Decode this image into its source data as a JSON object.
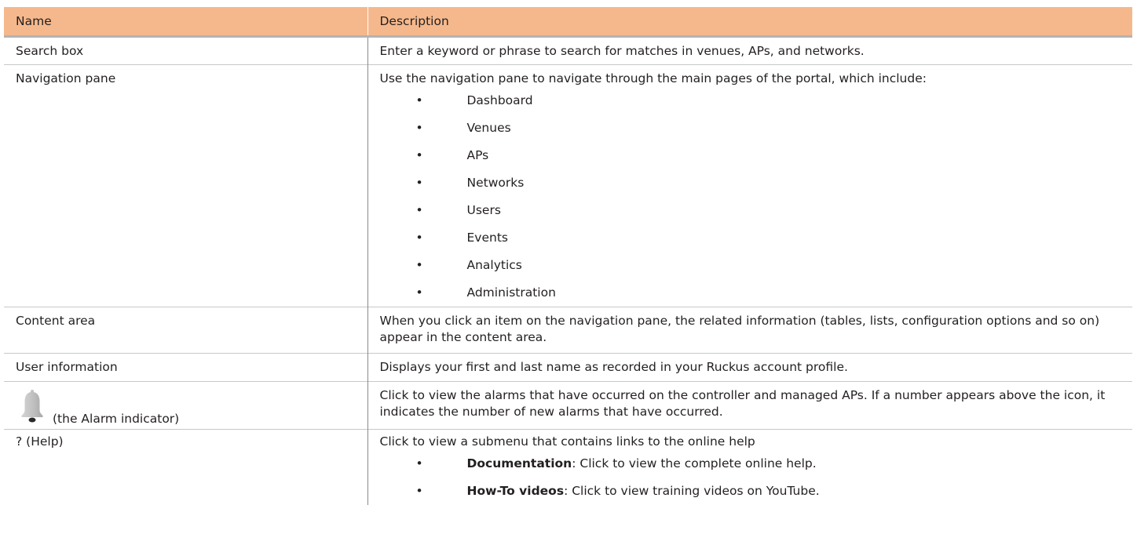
{
  "table": {
    "headers": {
      "name": "Name",
      "description": "Description"
    },
    "rows": {
      "search": {
        "name": "Search box",
        "description": "Enter a keyword or phrase to search for matches in venues, APs, and networks."
      },
      "navigation": {
        "name": "Navigation pane",
        "description": "Use the navigation pane to navigate through the main pages of the portal, which include:",
        "items": [
          "Dashboard",
          "Venues",
          "APs",
          "Networks",
          "Users",
          "Events",
          "Analytics",
          "Administration"
        ]
      },
      "content": {
        "name": "Content area",
        "description": "When you click an item on the navigation pane, the related information (tables, lists, configuration options and so on) appear in the content area."
      },
      "user": {
        "name": "User information",
        "description": "Displays your first and last name as recorded in your Ruckus account profile."
      },
      "alarm": {
        "icon": "bell-icon",
        "name": "(the Alarm indicator)",
        "description": "Click to view the alarms that have occurred on the controller and managed APs. If a number appears above the icon, it indicates the number of new alarms that have occurred."
      },
      "help": {
        "name": "? (Help)",
        "description": "Click to view a submenu that contains links to the online help",
        "items": [
          {
            "term": "Documentation",
            "text": ": Click to view the complete online help."
          },
          {
            "term": "How-To videos",
            "text": ": Click to view training videos on YouTube."
          }
        ]
      }
    },
    "bullet": "•"
  },
  "colors": {
    "header_bg": "#f5b88c",
    "text": "#231f20",
    "bell": "#b9b9b9"
  }
}
